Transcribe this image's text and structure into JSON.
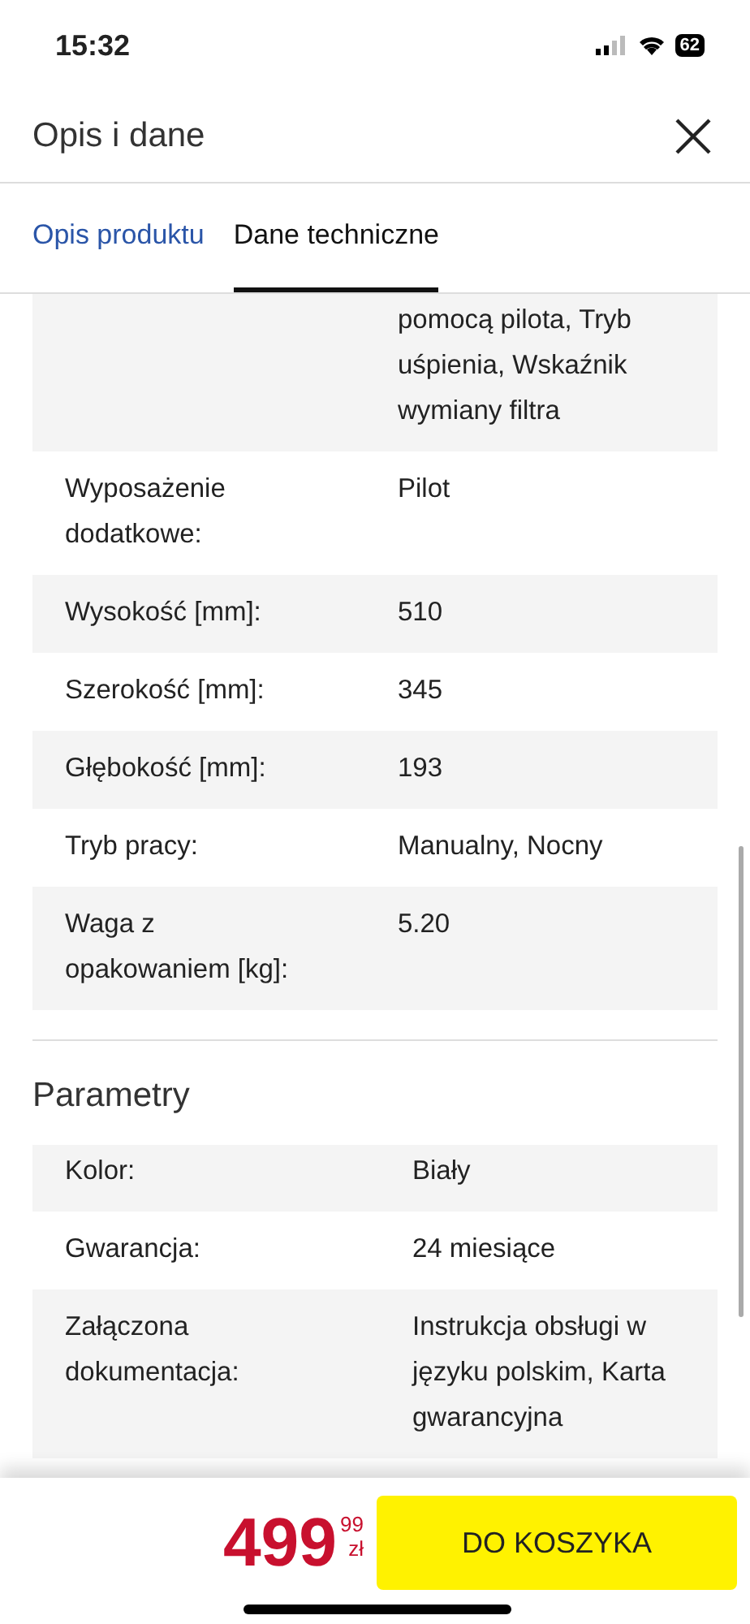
{
  "status_bar": {
    "time": "15:32",
    "battery": "62"
  },
  "header": {
    "title": "Opis i dane"
  },
  "tabs": [
    {
      "label": "Opis produktu",
      "selected": false
    },
    {
      "label": "Dane techniczne",
      "selected": true
    }
  ],
  "sections": [
    {
      "rows": [
        {
          "label": "",
          "value": "pomocą pilota, Tryb uśpienia, Wskaźnik wymiany filtra"
        },
        {
          "label": "Wyposażenie dodatkowe:",
          "value": "Pilot"
        },
        {
          "label": "Wysokość [mm]:",
          "value": "510"
        },
        {
          "label": "Szerokość [mm]:",
          "value": "345"
        },
        {
          "label": "Głębokość [mm]:",
          "value": "193"
        },
        {
          "label": "Tryb pracy:",
          "value": "Manualny, Nocny"
        },
        {
          "label": "Waga z opakowaniem [kg]:",
          "value": "5.20"
        }
      ]
    },
    {
      "title": "Parametry",
      "rows": [
        {
          "label": "Kolor:",
          "value": "Biały"
        },
        {
          "label": "Gwarancja:",
          "value": "24 miesiące"
        },
        {
          "label": "Załączona dokumentacja:",
          "value": "Instrukcja obsługi w języku polskim, Karta gwarancyjna"
        }
      ]
    }
  ],
  "footer": {
    "price_main": "499",
    "price_cents": "99",
    "currency": "zł",
    "cart_button": "DO KOSZYKA"
  }
}
